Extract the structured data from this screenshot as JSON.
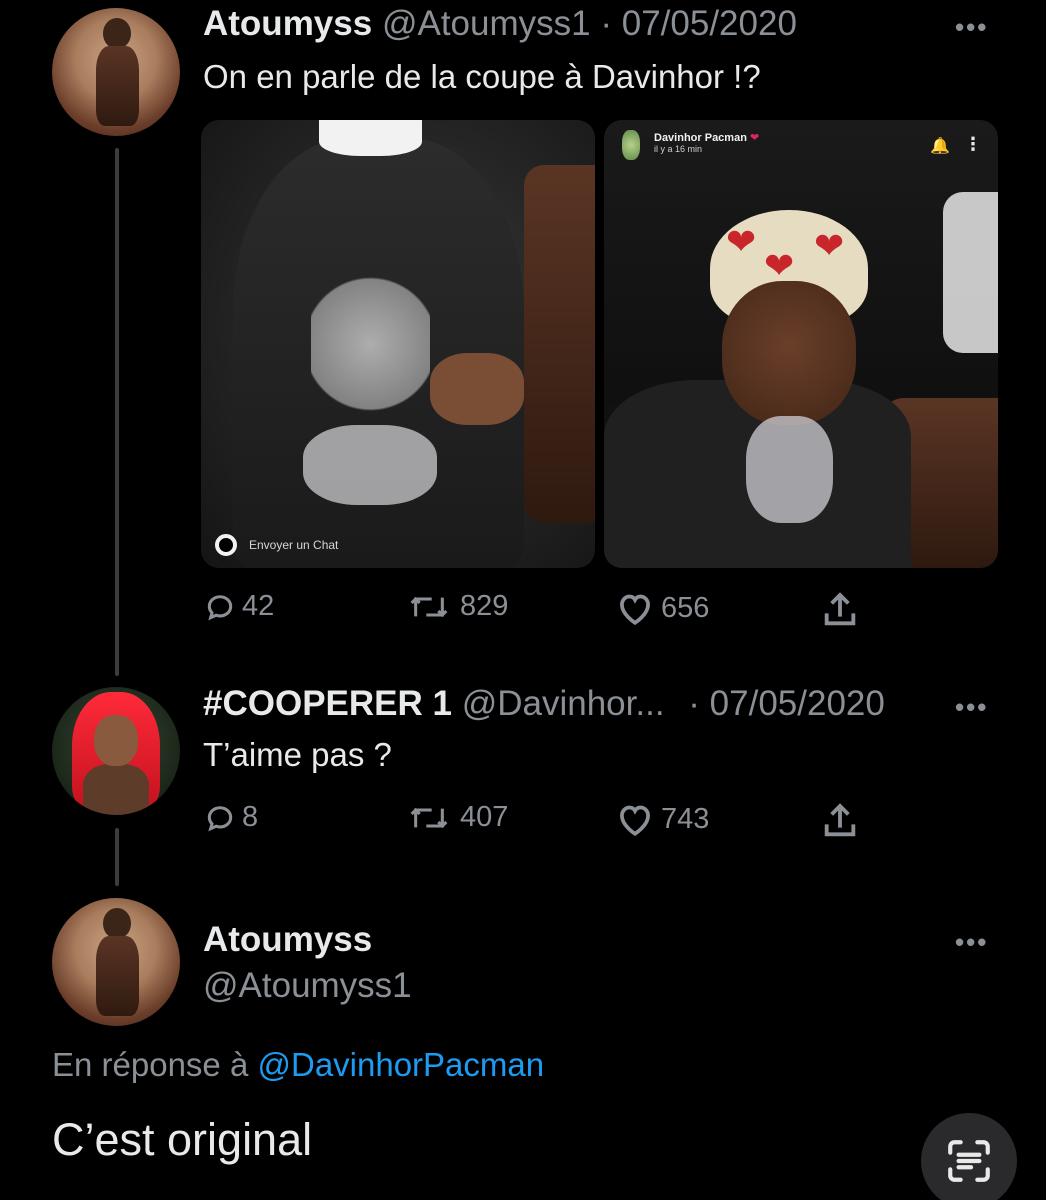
{
  "tweet1": {
    "name": "Atoumyss",
    "handle": "@Atoumyss1",
    "separator": "·",
    "date": "07/05/2020",
    "text": "On en parle de la coupe à Davinhor !?",
    "media": {
      "left_overlay_text": "Envoyer un Chat",
      "right_account_name": "Davinhor Pacman",
      "right_account_heart": "❤",
      "right_time": "il y a 16 min"
    },
    "actions": {
      "replies": "42",
      "retweets": "829",
      "likes": "656"
    }
  },
  "tweet2": {
    "name": "#COOPERER 1",
    "handle": "@Davinhor...",
    "separator": "·",
    "date": "07/05/2020",
    "text": "T’aime pas ?",
    "actions": {
      "replies": "8",
      "retweets": "407",
      "likes": "743"
    }
  },
  "tweet3": {
    "name": "Atoumyss",
    "handle": "@Atoumyss1",
    "reply_prefix": "En réponse à",
    "reply_mention": "@DavinhorPacman",
    "text": "C’est original"
  },
  "more_glyph": "•••",
  "icons": {
    "reply": "reply-icon",
    "retweet": "retweet-icon",
    "like": "heart-icon",
    "share": "share-icon",
    "scan": "text-scan-icon"
  },
  "colors": {
    "background": "#000000",
    "mention": "#1d9bf0",
    "muted": "#8b9096"
  }
}
